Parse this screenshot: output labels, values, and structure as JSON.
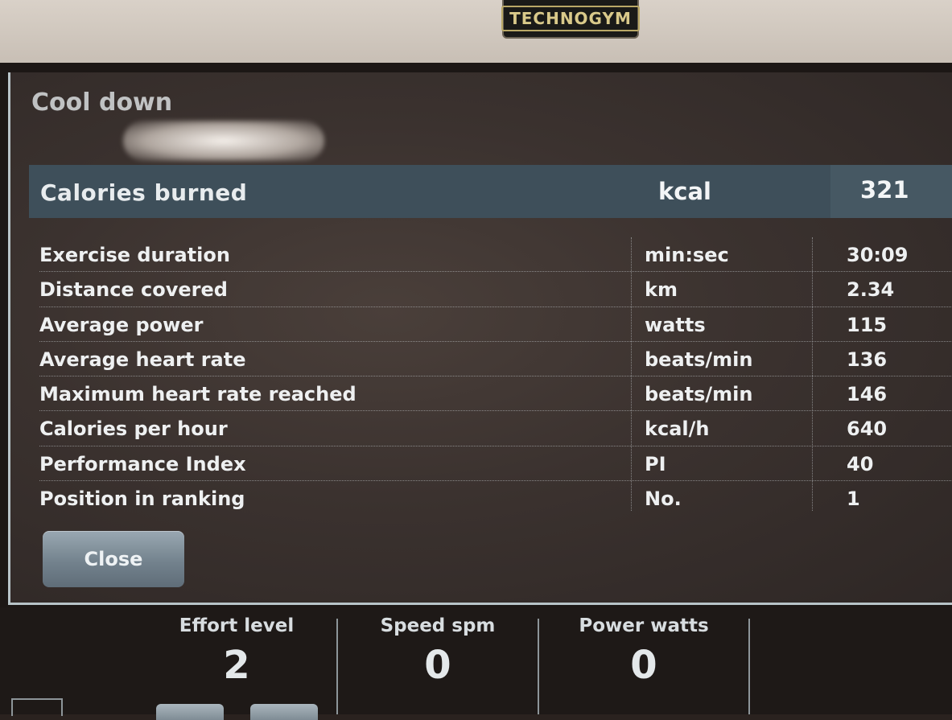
{
  "brand": {
    "logo_text": "TECHNOGYM"
  },
  "panel": {
    "title": "Cool down",
    "header": {
      "label": "Calories burned",
      "unit": "kcal",
      "value": "321"
    },
    "rows": [
      {
        "label": "Exercise duration",
        "unit": "min:sec",
        "value": "30:09"
      },
      {
        "label": "Distance covered",
        "unit": "km",
        "value": "2.34"
      },
      {
        "label": "Average power",
        "unit": "watts",
        "value": "115"
      },
      {
        "label": "Average heart rate",
        "unit": "beats/min",
        "value": "136"
      },
      {
        "label": "Maximum heart rate reached",
        "unit": "beats/min",
        "value": "146"
      },
      {
        "label": "Calories per hour",
        "unit": "kcal/h",
        "value": "640"
      },
      {
        "label": "Performance Index",
        "unit": "PI",
        "value": "40"
      },
      {
        "label": "Position in ranking",
        "unit": "No.",
        "value": "1"
      }
    ],
    "close_label": "Close"
  },
  "bottom": {
    "metrics": [
      {
        "label": "Effort level",
        "value": "2"
      },
      {
        "label": "Speed spm",
        "value": "0"
      },
      {
        "label": "Power watts",
        "value": "0"
      }
    ]
  },
  "colors": {
    "header_bg": "#3e4f5a",
    "panel_bg": "#3b322f",
    "text": "#eef0f1",
    "accent_border": "#b8c4c8"
  }
}
